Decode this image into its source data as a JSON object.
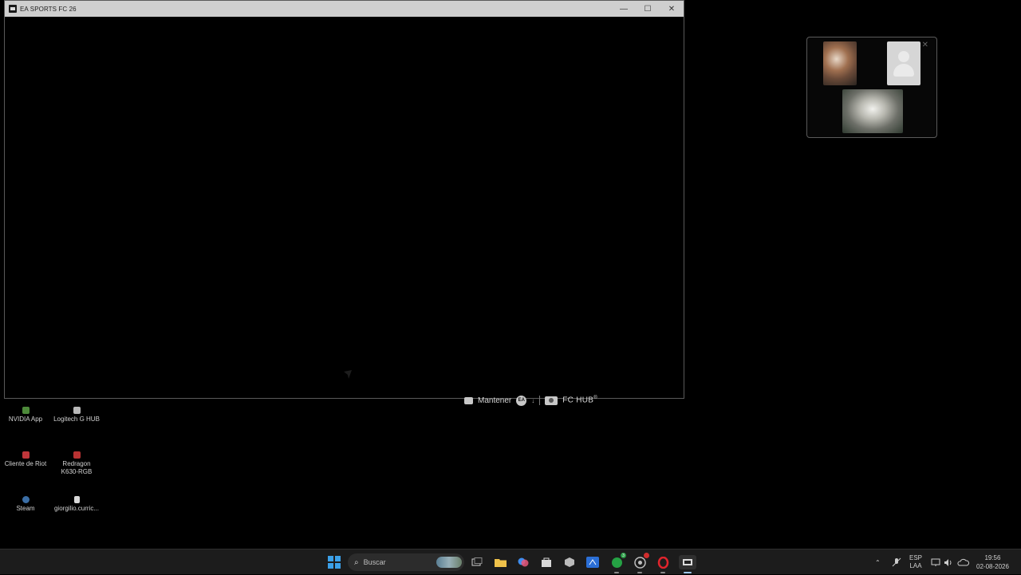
{
  "window": {
    "title": "EA SPORTS FC 26",
    "minimize_glyph": "—",
    "maximize_glyph": "☐",
    "close_glyph": "✕"
  },
  "hint_bar": {
    "keep_label": "Mantener",
    "ea_badge": "EA",
    "fc_hub_label": "FC HUB",
    "fc_hub_mark": "®"
  },
  "call_panel": {
    "close_glyph": "✕"
  },
  "desktop_icons": [
    {
      "label": "NVIDIA App",
      "icon": "nvidia-icon"
    },
    {
      "label": "Logitech G HUB",
      "icon": "logitech-icon"
    },
    {
      "label": "Cliente de Riot",
      "icon": "riot-icon"
    },
    {
      "label": "Redragon K630-RGB",
      "icon": "redragon-icon"
    },
    {
      "label": "Steam",
      "icon": "steam-icon"
    },
    {
      "label": "giorgilio.curric...",
      "icon": "file-icon"
    }
  ],
  "taskbar": {
    "search_placeholder": "Buscar",
    "whatsapp_badge": "3",
    "language_line1": "ESP",
    "language_line2": "LAA",
    "time": "19:56",
    "date": "02-08-2026"
  },
  "colors": {
    "titlebar": "#cfcfcf",
    "taskbar": "#1c1c1c",
    "windows_blue": "#3ba0e8",
    "whatsapp_green": "#25a244",
    "opera_red": "#e0242c"
  }
}
